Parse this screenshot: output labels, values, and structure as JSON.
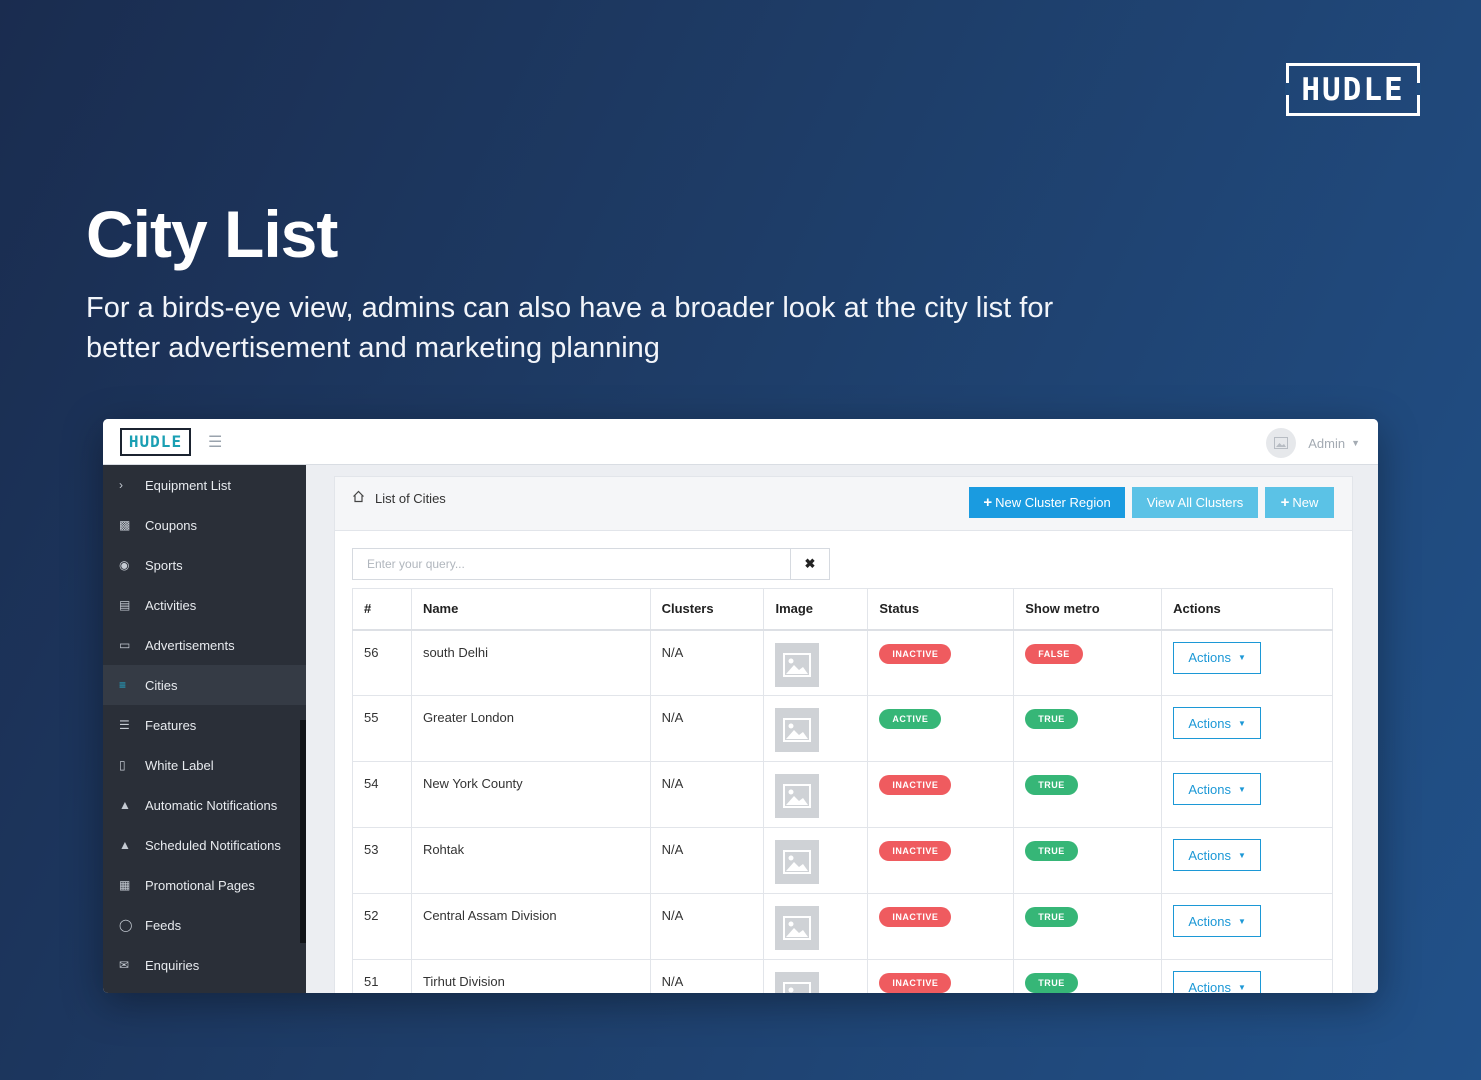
{
  "brand": {
    "logo_text": "HUDLE"
  },
  "hero": {
    "title": "City List",
    "subtitle": "For a birds-eye view, admins can also have a broader look at the city list for better advertisement and marketing planning"
  },
  "app": {
    "logo_text": "HUDLE",
    "user": {
      "name": "Admin"
    },
    "sidebar": {
      "items": [
        {
          "label": "Equipment List",
          "icon": "chevron-right-icon"
        },
        {
          "label": "Coupons",
          "icon": "gift-icon"
        },
        {
          "label": "Sports",
          "icon": "trophy-icon"
        },
        {
          "label": "Activities",
          "icon": "document-icon"
        },
        {
          "label": "Advertisements",
          "icon": "monitor-icon"
        },
        {
          "label": "Cities",
          "icon": "signpost-icon",
          "active": true
        },
        {
          "label": "Features",
          "icon": "list-icon"
        },
        {
          "label": "White Label",
          "icon": "mobile-icon"
        },
        {
          "label": "Automatic Notifications",
          "icon": "bell-icon"
        },
        {
          "label": "Scheduled Notifications",
          "icon": "bell-icon"
        },
        {
          "label": "Promotional Pages",
          "icon": "file-icon"
        },
        {
          "label": "Feeds",
          "icon": "comment-icon"
        },
        {
          "label": "Enquiries",
          "icon": "envelope-icon"
        }
      ]
    },
    "breadcrumb": "List of Cities",
    "buttons": {
      "new_cluster_region": "New Cluster Region",
      "view_all_clusters": "View All Clusters",
      "new": "New"
    },
    "search": {
      "placeholder": "Enter your query...",
      "clear": "✖"
    },
    "table": {
      "columns": [
        "#",
        "Name",
        "Clusters",
        "Image",
        "Status",
        "Show metro",
        "Actions"
      ],
      "rows": [
        {
          "id": "56",
          "name": "south Delhi",
          "clusters": "N/A",
          "status": "INACTIVE",
          "show_metro": "FALSE",
          "actions": "Actions"
        },
        {
          "id": "55",
          "name": "Greater London",
          "clusters": "N/A",
          "status": "ACTIVE",
          "show_metro": "TRUE",
          "actions": "Actions"
        },
        {
          "id": "54",
          "name": "New York County",
          "clusters": "N/A",
          "status": "INACTIVE",
          "show_metro": "TRUE",
          "actions": "Actions"
        },
        {
          "id": "53",
          "name": "Rohtak",
          "clusters": "N/A",
          "status": "INACTIVE",
          "show_metro": "TRUE",
          "actions": "Actions"
        },
        {
          "id": "52",
          "name": "Central Assam Division",
          "clusters": "N/A",
          "status": "INACTIVE",
          "show_metro": "TRUE",
          "actions": "Actions"
        },
        {
          "id": "51",
          "name": "Tirhut Division",
          "clusters": "N/A",
          "status": "INACTIVE",
          "show_metro": "TRUE",
          "actions": "Actions"
        }
      ]
    },
    "colors": {
      "accent": "#1a9be0",
      "accent_light": "#5bc2e6",
      "inactive": "#ef5b5f",
      "active": "#36b677",
      "sidebar_bg": "#2a2f38"
    }
  }
}
